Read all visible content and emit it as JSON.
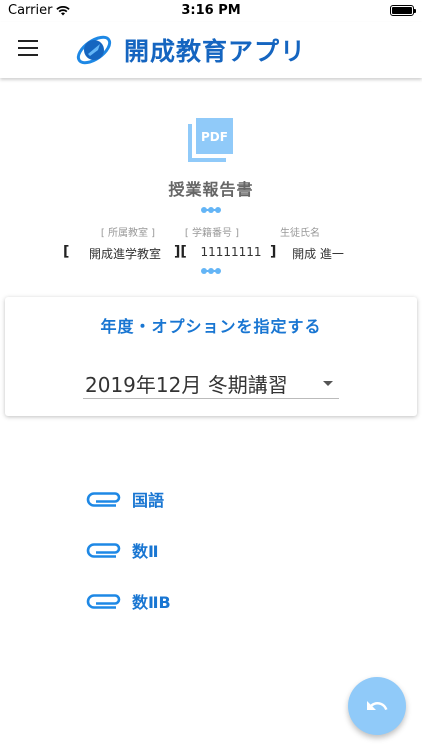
{
  "status_bar": {
    "carrier": "Carrier",
    "time": "3:16 PM"
  },
  "app_bar": {
    "title": "開成教育アプリ"
  },
  "report": {
    "title": "授業報告書",
    "fields": [
      {
        "label": "[ 所属教室 ]",
        "value": "開成進学教室"
      },
      {
        "label": "[ 学籍番号 ]",
        "value": "11111111"
      },
      {
        "label": "生徒氏名",
        "value": "開成 進一"
      }
    ],
    "brackets": [
      "[",
      "][",
      "]"
    ]
  },
  "options_card": {
    "title": "年度・オプションを指定する",
    "selected_value": "2019年12月 冬期講習"
  },
  "subjects": [
    {
      "label": "国語"
    },
    {
      "label": "数Ⅱ"
    },
    {
      "label": "数ⅡB"
    }
  ],
  "colors": {
    "brand": "#1565c0",
    "accent": "#1976d2",
    "fab": "#90caf9"
  },
  "icons": {
    "menu": "hamburger-menu-icon",
    "pdf": "pdf-icon",
    "subject": "paperclip-icon",
    "fab": "undo-icon"
  }
}
